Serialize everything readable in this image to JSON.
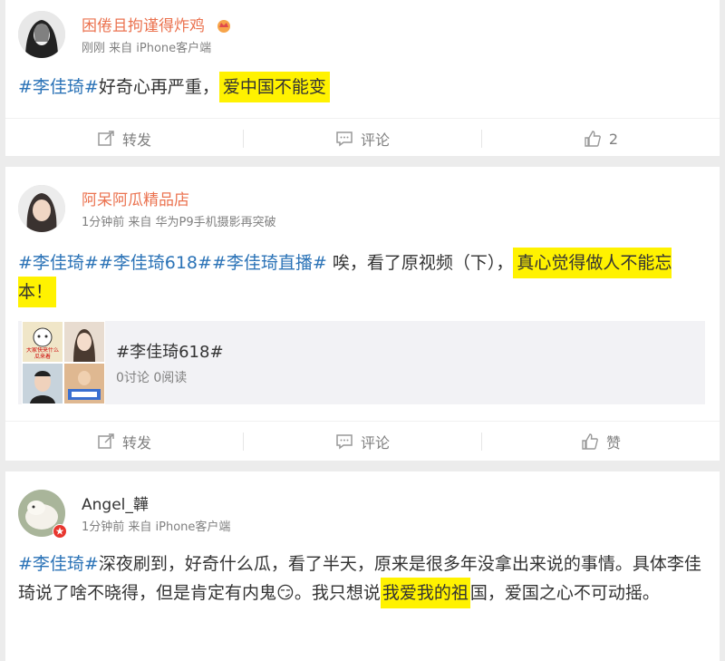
{
  "posts": [
    {
      "name": "困倦且拘谨得炸鸡",
      "meta": "刚刚 来自 iPhone客户端",
      "text": [
        {
          "t": "#李佳琦#",
          "k": "tag"
        },
        {
          "t": "好奇心再严重，",
          "k": ""
        },
        {
          "t": "爱中国不能变",
          "k": "hl"
        }
      ],
      "actions": {
        "repost": "转发",
        "comment": "评论",
        "like": "2"
      }
    },
    {
      "name": "阿呆阿瓜精品店",
      "meta": "1分钟前 来自 华为P9手机摄影再突破",
      "text": [
        {
          "t": "#李佳琦##李佳琦618##李佳琦直播#",
          "k": "tag"
        },
        {
          "t": " 唉，看了原视频（下），",
          "k": ""
        },
        {
          "t": "真心觉得做人不能忘本！",
          "k": "hl"
        }
      ],
      "topic": {
        "title": "#李佳琦618#",
        "stats": "0讨论 0阅读",
        "thumb_caption": "大家快来什么瓜来着"
      },
      "actions": {
        "repost": "转发",
        "comment": "评论",
        "like": "赞"
      }
    },
    {
      "name": "Angel_韡",
      "meta": "1分钟前 来自 iPhone客户端",
      "text": [
        {
          "t": "#李佳琦#",
          "k": "tag"
        },
        {
          "t": "深夜刷到，好奇什么瓜，看了半天，原来是很多年没拿出来说的事情。具体李佳琦说了啥不晓得，但是肯定有内鬼",
          "k": ""
        },
        {
          "t": "😏",
          "k": "emoji"
        },
        {
          "t": "。我只想说",
          "k": ""
        },
        {
          "t": "我爱我的祖",
          "k": "hl"
        },
        {
          "t": "国，爱国之心不可动摇。",
          "k": ""
        }
      ]
    }
  ],
  "colors": {
    "name": "#eb7350",
    "tag": "#2b73b7",
    "highlight": "#fff200",
    "meta": "#808080"
  }
}
